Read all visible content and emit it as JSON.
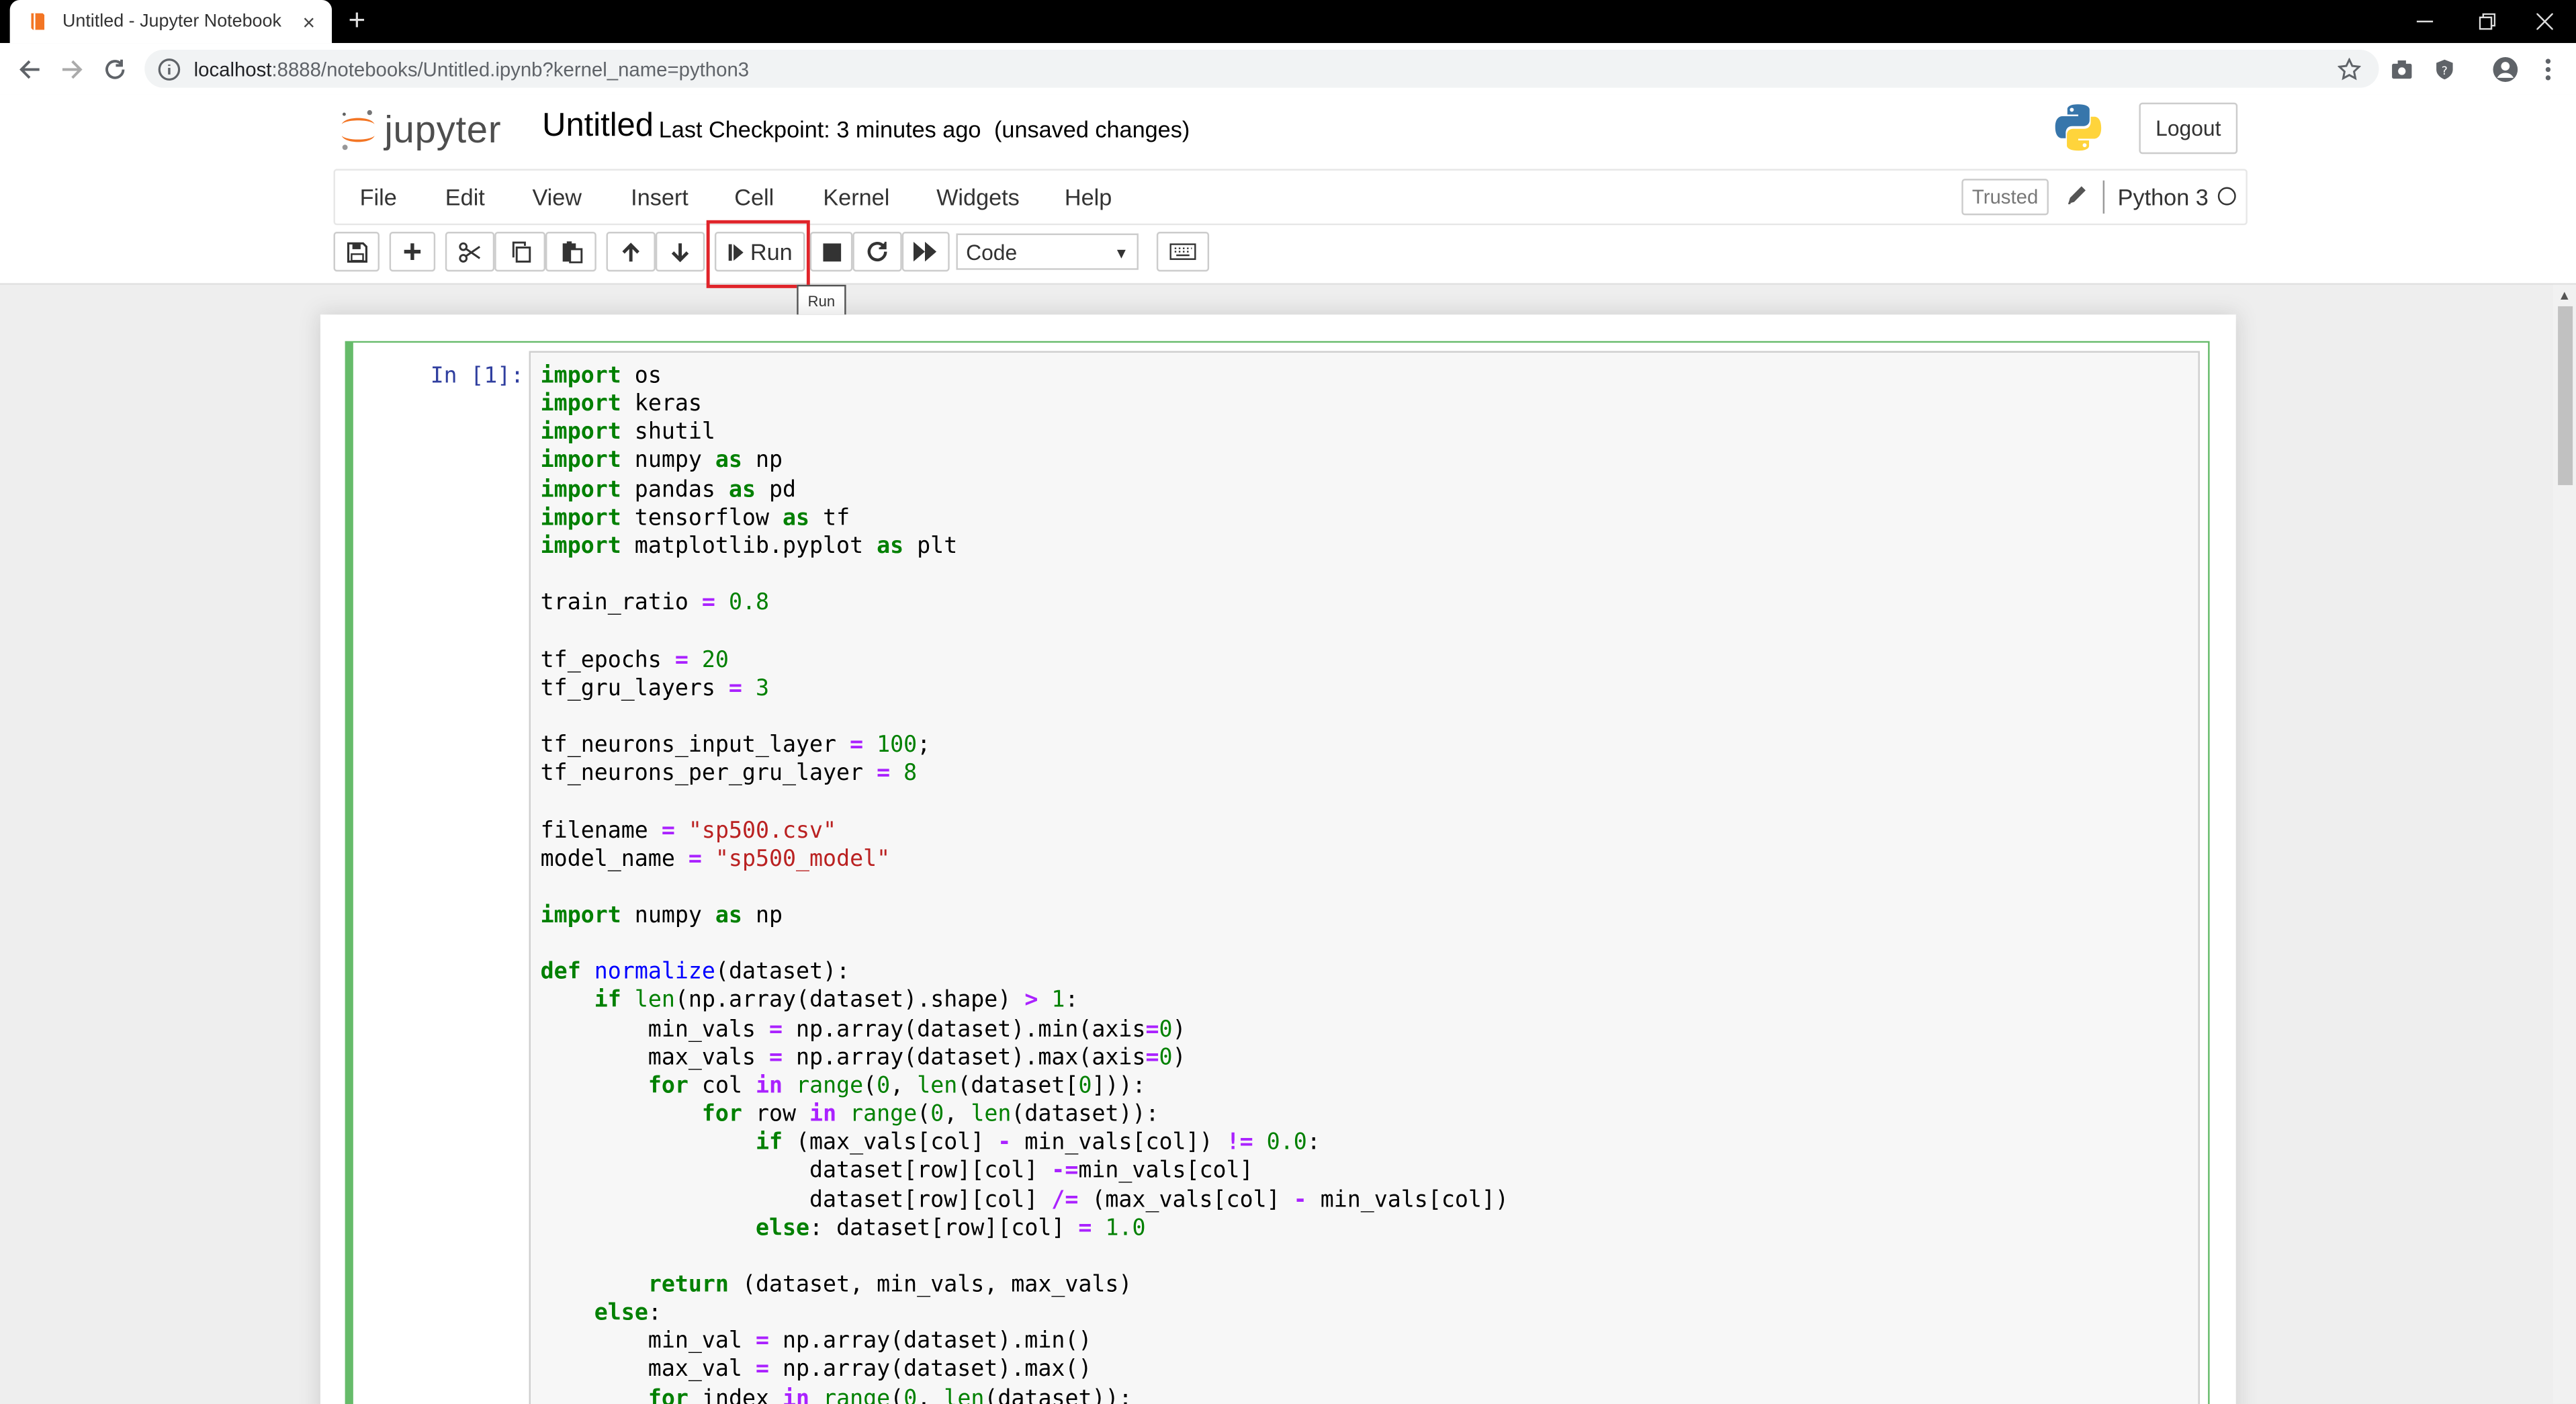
{
  "browser": {
    "tab_title": "Untitled - Jupyter Notebook",
    "tab_close": "×",
    "new_tab": "+",
    "url_host": "localhost",
    "url_rest": ":8888/notebooks/Untitled.ipynb?kernel_name=python3"
  },
  "header": {
    "logo_text": "jupyter",
    "notebook_name": "Untitled",
    "checkpoint": "Last Checkpoint: 3 minutes ago",
    "unsaved": "(unsaved changes)",
    "logout_label": "Logout"
  },
  "menubar": {
    "items": [
      "File",
      "Edit",
      "View",
      "Insert",
      "Cell",
      "Kernel",
      "Widgets",
      "Help"
    ],
    "trusted_label": "Trusted",
    "kernel_name": "Python 3"
  },
  "toolbar": {
    "run_label": "Run",
    "cell_type": "Code",
    "tooltip": "Run"
  },
  "cell": {
    "prompt": "In [1]:"
  },
  "colors": {
    "accent_highlight": "#e0242a",
    "cell_border": "#66bb6a",
    "prompt": "#303f9f"
  }
}
